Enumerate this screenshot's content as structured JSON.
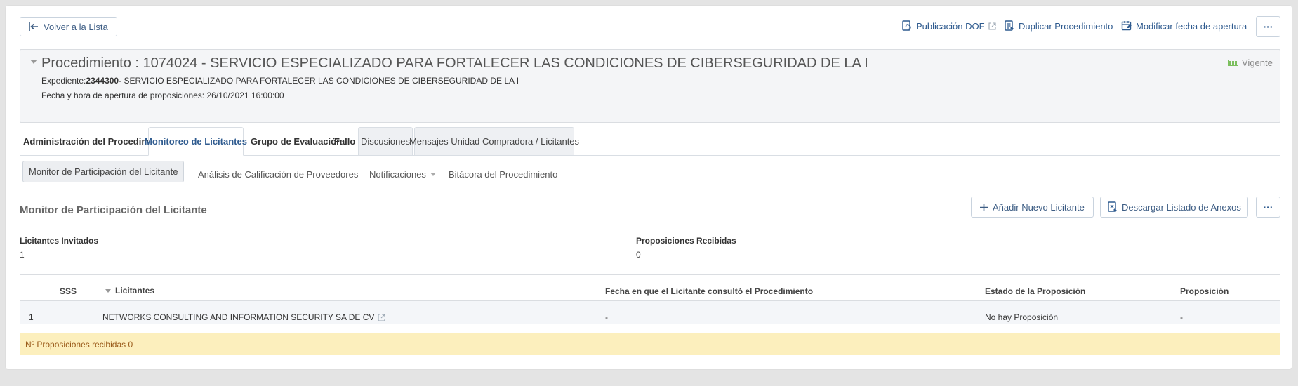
{
  "toolbar": {
    "back_label": "Volver a la Lista",
    "dof_label": "Publicación DOF",
    "duplicate_label": "Duplicar Procedimiento",
    "modify_label": "Modificar fecha de apertura",
    "more_label": "···"
  },
  "header": {
    "title": "Procedimiento : 1074024 - SERVICIO ESPECIALIZADO PARA FORTALECER LAS CONDICIONES DE CIBERSEGURIDAD DE LA I",
    "expediente_label": "Expediente:",
    "expediente_number": "2344300",
    "expediente_desc": "- SERVICIO ESPECIALIZADO PARA FORTALECER LAS CONDICIONES DE CIBERSEGURIDAD DE LA I",
    "fecha": "Fecha y hora de apertura de proposiciones: 26/10/2021 16:00:00",
    "status": "Vigente"
  },
  "tabs": [
    {
      "label": "Administración del Procedimiento"
    },
    {
      "label": "Monitoreo de Licitantes"
    },
    {
      "label": "Grupo de Evaluación"
    },
    {
      "label": "Fallo"
    },
    {
      "label": "Discusiones"
    },
    {
      "label": "Mensajes Unidad Compradora / Licitantes"
    }
  ],
  "subtabs": [
    {
      "label": "Monitor de Participación del Licitante"
    },
    {
      "label": "Análisis de Calificación de Proveedores"
    },
    {
      "label": "Notificaciones"
    },
    {
      "label": "Bitácora del Procedimiento"
    }
  ],
  "section": {
    "title": "Monitor de Participación del Licitante",
    "add_label": "Añadir Nuevo Licitante",
    "download_label": "Descargar Listado de Anexos",
    "more_label": "···"
  },
  "stats": {
    "invited_label": "Licitantes Invitados",
    "invited_value": "1",
    "received_label": "Proposiciones Recibidas",
    "received_value": "0"
  },
  "table": {
    "headers": [
      "SSS",
      "Licitantes",
      "Fecha en que el Licitante consultó el Procedimiento",
      "Estado de la Proposición",
      "Proposición"
    ],
    "rows": [
      [
        "1",
        "NETWORKS CONSULTING AND INFORMATION SECURITY SA DE CV",
        "-",
        "No hay Proposición",
        "-"
      ]
    ]
  },
  "footer_note": "Nº Proposiciones recibidas 0",
  "colors": {
    "accent": "#2f5b8f",
    "status_green": "#7cbf5e",
    "note_bg": "#fcefbd",
    "note_text": "#9a5b1a"
  }
}
